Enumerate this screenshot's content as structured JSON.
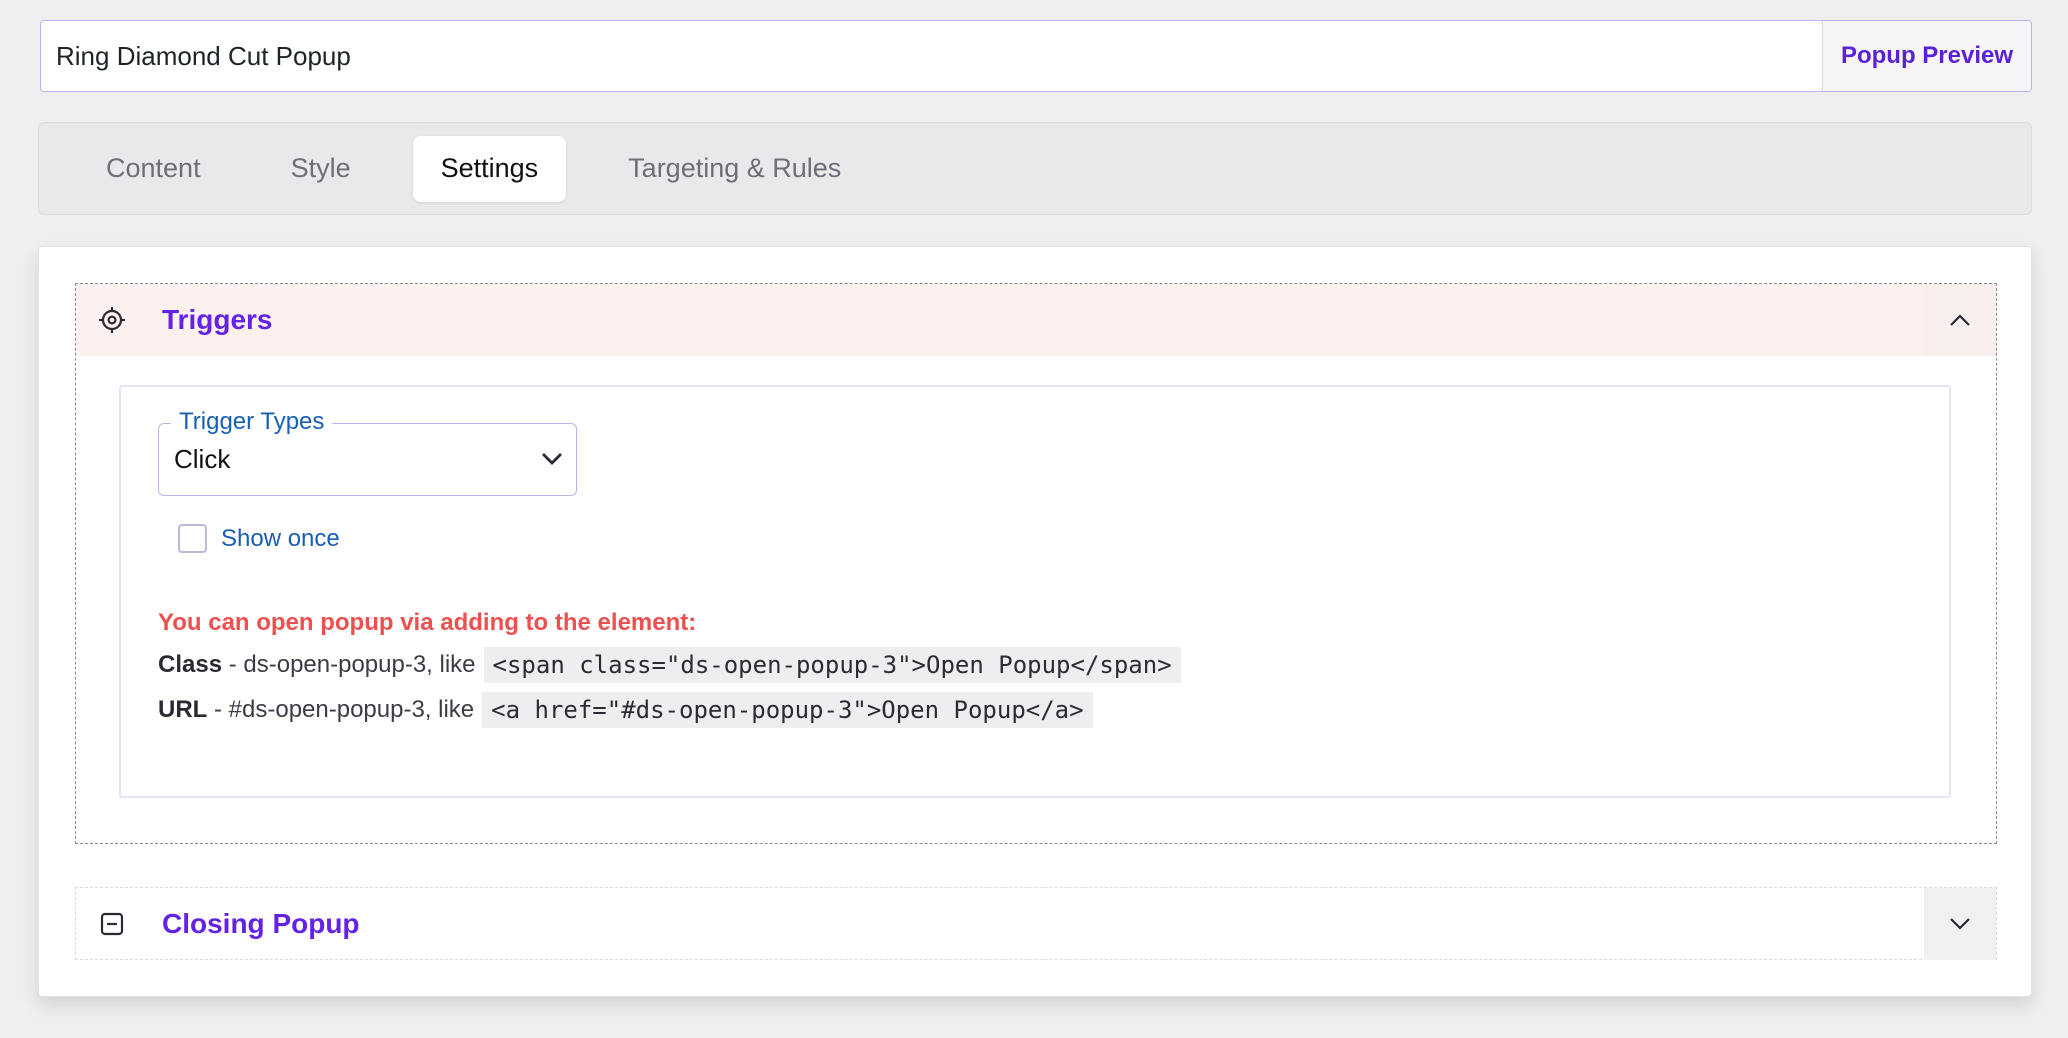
{
  "title_field": {
    "value": "Ring Diamond Cut Popup",
    "preview_label": "Popup Preview"
  },
  "tabs": [
    {
      "label": "Content",
      "active": false
    },
    {
      "label": "Style",
      "active": false
    },
    {
      "label": "Settings",
      "active": true
    },
    {
      "label": "Targeting & Rules",
      "active": false
    }
  ],
  "triggers": {
    "title": "Triggers",
    "trigger_types_label": "Trigger Types",
    "trigger_type_value": "Click",
    "show_once_label": "Show once",
    "show_once_checked": false,
    "note": "You can open popup via adding to the element:",
    "class_line": {
      "label": "Class",
      "text": " - ds-open-popup-3, like",
      "code": "<span class=\"ds-open-popup-3\">Open Popup</span>"
    },
    "url_line": {
      "label": "URL",
      "text": " - #ds-open-popup-3, like",
      "code": "<a href=\"#ds-open-popup-3\">Open Popup</a>"
    }
  },
  "closing": {
    "title": "Closing Popup"
  },
  "colors": {
    "accent": "#6322e6",
    "link_blue": "#1a5fb4",
    "note_red": "#ee5050",
    "header_tint": "#fdf1ef"
  },
  "icons": {
    "triggers": "target-icon",
    "closing": "minus-square-icon",
    "collapse": "chevron-up-icon",
    "expand": "chevron-down-icon",
    "select": "chevron-down-icon"
  }
}
